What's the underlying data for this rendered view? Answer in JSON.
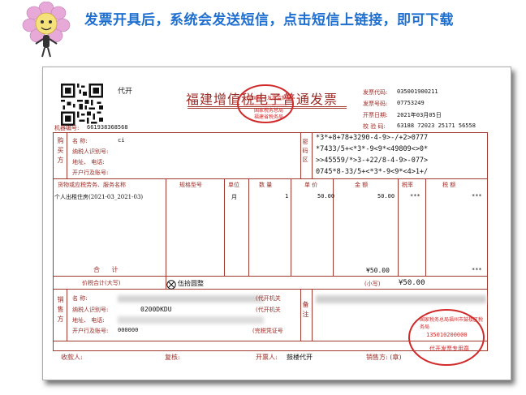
{
  "banner": {
    "text": "发票开具后，系统会发送短信，点击短信上链接，即可下载"
  },
  "invoice": {
    "issue_type": "代开",
    "title": "福建增值税电子普通发票",
    "machine_no_label": "机器编号:",
    "machine_no": "661938368568",
    "code_label": "发票代码:",
    "code": "035001900211",
    "number_label": "发票号码:",
    "number": "07753249",
    "date_label": "开票日期:",
    "date": "2021年03月05日",
    "check_label": "校 验 码:",
    "check_code": "63188 72023 25171 56558",
    "buyer_section": "购买方",
    "buyer_name_label": "名 称:",
    "buyer_name": "ci",
    "buyer_taxid_label": "纳税人识别号:",
    "buyer_addr_label": "地址、 电话:",
    "buyer_bank_label": "开户行及账号:",
    "cipher_section": "密码区",
    "cipher_lines": [
      "*3*+8+78+3290-4-9>-/+2>0777",
      "*7433/5+<*3*-9<9*<49809<>0*",
      ">>45559/*>3-+22/8-4-9>-077>",
      "0745*8-33/5+<*3*-9<9*<4>1+/"
    ],
    "columns": [
      "货物或应税劳务、服务名称",
      "规格型号",
      "单位",
      "数 量",
      "单 价",
      "金 额",
      "税率",
      "税 额"
    ],
    "item": {
      "name": "个人出租住房(2021-03_2021-03)",
      "unit": "月",
      "qty": "1",
      "price": "50.00",
      "amount": "50.00",
      "tax_rate": "***",
      "tax": "***"
    },
    "total_label": "合 计",
    "total_amount": "¥50.00",
    "total_tax": "***",
    "total_words_label": "价税合计(大写)",
    "total_words": "伍拾圆整",
    "total_small_label": "(小写)",
    "total_small": "¥50.00",
    "seller_section": "销售方",
    "seller_name_label": "名 称:",
    "seller_taxid_label": "纳税人识别号:",
    "seller_taxid_partial": "0200DKDU",
    "seller_addr_label": "地址、 电话:",
    "seller_bank_label": "开户行及账号:",
    "seller_bank_value": "000000",
    "agency_label_1": "(代开机关",
    "agency_label_2": "(代开机关",
    "voucher_label": "(完税凭证号",
    "notes_section": "备注",
    "payee_label": "收款人:",
    "reviewer_label": "复核:",
    "drawer_label": "开票人:",
    "drawer": "鼓楼代开",
    "seller_sign_label": "销售方: (章)",
    "stamp_top_text": "全国统一发票监制章",
    "stamp_mid_text": "国家税务总局",
    "stamp_bottom_text": "福建省税务局",
    "stamp2_text": "国家税务总局福州市鼓楼区税务局",
    "stamp2_code": "135010200000",
    "stamp2_bottom": "代开发票专用章"
  }
}
